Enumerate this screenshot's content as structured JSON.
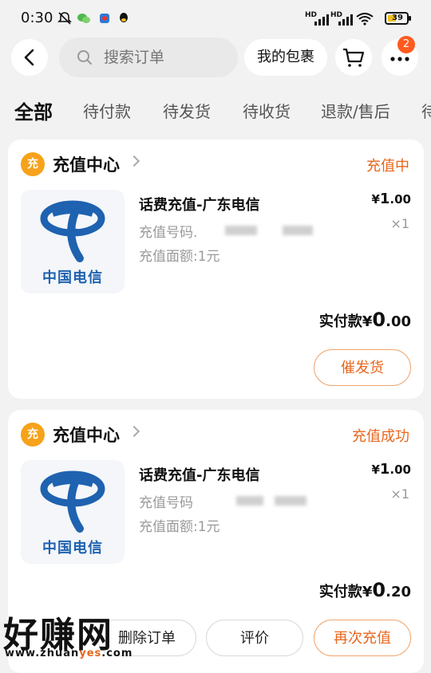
{
  "status_bar": {
    "time": "0:30",
    "battery": "39",
    "network1": "HD",
    "network2": "HD"
  },
  "header": {
    "search_placeholder": "搜索订单",
    "package_label": "我的包裹",
    "notification_count": "2"
  },
  "tabs": [
    "全部",
    "待付款",
    "待发货",
    "待收货",
    "退款/售后",
    "待"
  ],
  "orders": [
    {
      "shop_badge": "充",
      "shop_name": "充值中心",
      "status": "充值中",
      "logo_caption": "中国电信",
      "title": "话费充值-广东电信",
      "number_label": "充值号码.",
      "face_value": "充值面额:1元",
      "price_symbol": "¥",
      "price_int": "1",
      "price_dec": ".00",
      "quantity": "×1",
      "paid_label": "实付款",
      "paid_symbol": "¥",
      "paid_int": "0",
      "paid_dec": ".00",
      "buttons": [
        "催发货"
      ]
    },
    {
      "shop_badge": "充",
      "shop_name": "充值中心",
      "status": "充值成功",
      "logo_caption": "中国电信",
      "title": "话费充值-广东电信",
      "number_label": "充值号码",
      "face_value": "充值面额:1元",
      "price_symbol": "¥",
      "price_int": "1",
      "price_dec": ".00",
      "quantity": "×1",
      "paid_label": "实付款",
      "paid_symbol": "¥",
      "paid_int": "0",
      "paid_dec": ".20",
      "buttons": [
        "删除订单",
        "评价",
        "再次充值"
      ]
    }
  ],
  "watermark": {
    "main": "好赚网",
    "url_prefix": "www.zhuan",
    "url_highlight": "yes",
    "url_suffix": ".com"
  },
  "colors": {
    "accent": "#e8661c",
    "telecom_blue": "#1f62b0",
    "badge": "#ff5a1f"
  }
}
